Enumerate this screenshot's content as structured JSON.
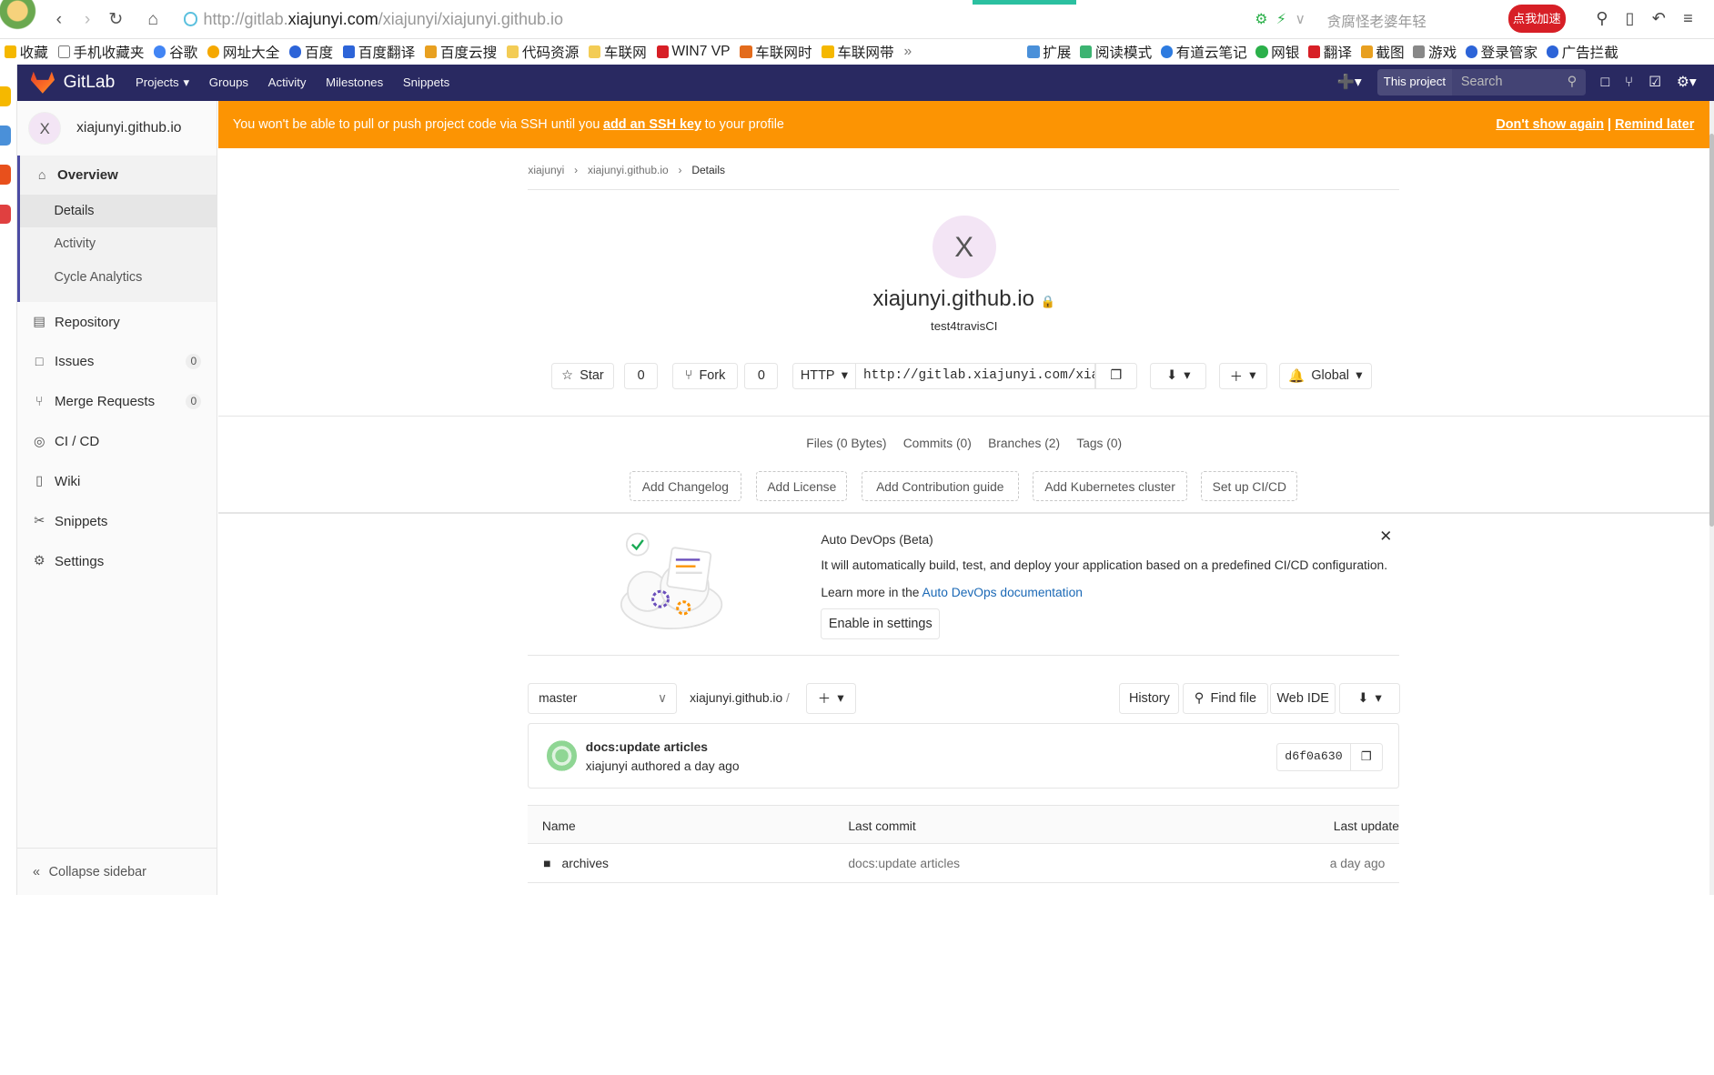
{
  "browser": {
    "url_prefix": "http://gitlab.",
    "url_domain": "xiajunyi.com",
    "url_path": "/xiajunyi/xiajunyi.github.io",
    "search_hint": "贪腐怪老婆年轻",
    "promo_label": "点我加速",
    "bookmarks_left": [
      "收藏",
      "手机收藏夹",
      "谷歌",
      "网址大全",
      "百度",
      "百度翻译",
      "百度云搜",
      "代码资源",
      "车联网",
      "WIN7 VP",
      "车联网时",
      "车联网带",
      "»"
    ],
    "bookmarks_right": [
      "扩展",
      "阅读模式",
      "有道云笔记",
      "网银",
      "翻译",
      "截图",
      "游戏",
      "登录管家",
      "广告拦截"
    ]
  },
  "gitlab_header": {
    "brand": "GitLab",
    "nav": [
      "Projects",
      "Groups",
      "Activity",
      "Milestones",
      "Snippets"
    ],
    "scope_label": "This project",
    "search_placeholder": "Search"
  },
  "sidebar": {
    "project_name": "xiajunyi.github.io",
    "avatar_letter": "X",
    "overview_label": "Overview",
    "overview_sub": [
      "Details",
      "Activity",
      "Cycle Analytics"
    ],
    "items": [
      {
        "label": "Repository",
        "count": ""
      },
      {
        "label": "Issues",
        "count": "0"
      },
      {
        "label": "Merge Requests",
        "count": "0"
      },
      {
        "label": "CI / CD",
        "count": ""
      },
      {
        "label": "Wiki",
        "count": ""
      },
      {
        "label": "Snippets",
        "count": ""
      },
      {
        "label": "Settings",
        "count": ""
      }
    ],
    "collapse_label": "Collapse sidebar"
  },
  "banner": {
    "text_before": "You won't be able to pull or push project code via SSH until you",
    "link": "add an SSH key",
    "text_after": "to your profile",
    "dont_show": "Don't show again",
    "separator": "|",
    "remind": "Remind later"
  },
  "breadcrumb": [
    "xiajunyi",
    "xiajunyi.github.io",
    "Details"
  ],
  "project": {
    "avatar_letter": "X",
    "title": "xiajunyi.github.io",
    "description": "test4travisCI",
    "star_label": "Star",
    "star_count": "0",
    "fork_label": "Fork",
    "fork_count": "0",
    "protocol": "HTTP",
    "clone_url": "http://gitlab.xiajunyi.com/xiajunyi/xiajunyi.github.io.git",
    "notification": "Global"
  },
  "stats": [
    "Files (0 Bytes)",
    "Commits (0)",
    "Branches (2)",
    "Tags (0)"
  ],
  "quick_actions": [
    "Add Changelog",
    "Add License",
    "Add Contribution guide",
    "Add Kubernetes cluster",
    "Set up CI/CD"
  ],
  "devops": {
    "title": "Auto DevOps (Beta)",
    "description": "It will automatically build, test, and deploy your application based on a predefined CI/CD configuration.",
    "learn_prefix": "Learn more in the",
    "learn_link": "Auto DevOps documentation",
    "enable_label": "Enable in settings",
    "close_glyph": "✕"
  },
  "repo": {
    "branch": "master",
    "path": "xiajunyi.github.io",
    "path_sep": "/",
    "history": "History",
    "find_file": "Find file",
    "web_ide": "Web IDE"
  },
  "last_commit": {
    "message": "docs:update articles",
    "author_line": "xiajunyi authored a day ago",
    "sha": "d6f0a630"
  },
  "files": {
    "headers": [
      "Name",
      "Last commit",
      "Last update"
    ],
    "rows": [
      {
        "name": "archives",
        "commit": "docs:update articles",
        "updated": "a day ago"
      }
    ]
  },
  "colors": {
    "header_bg": "#292961",
    "banner_bg": "#fc9403",
    "sidebar_active": "#4b4ba3",
    "link": "#1b69b6"
  }
}
